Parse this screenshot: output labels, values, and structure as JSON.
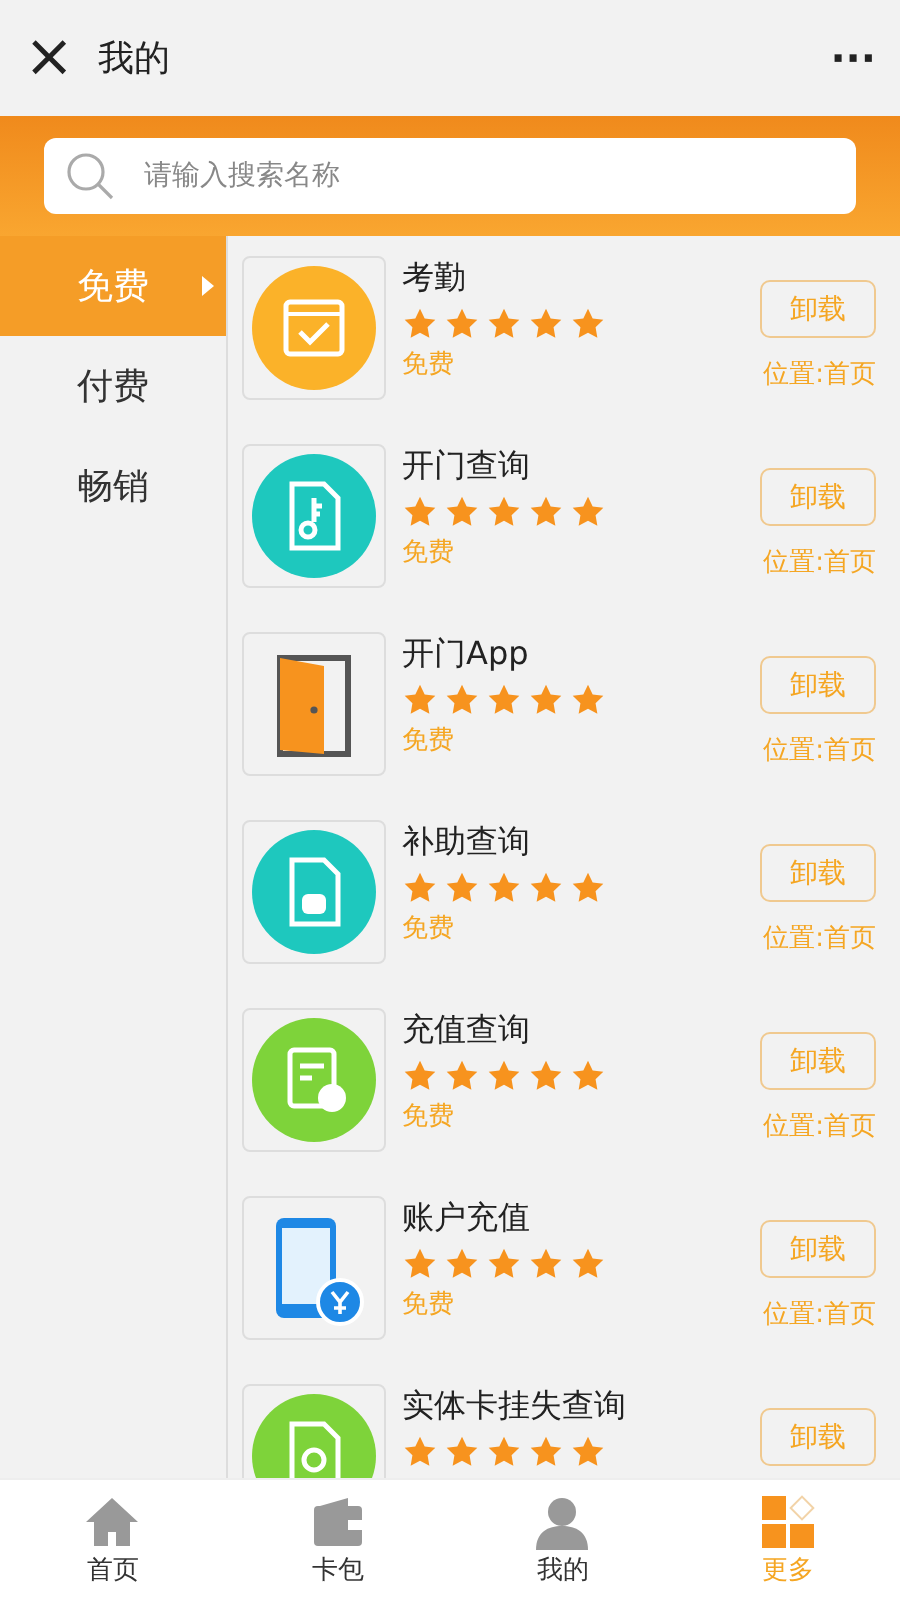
{
  "header": {
    "close": "×",
    "title": "我的",
    "more": "···"
  },
  "search": {
    "placeholder": "请输入搜索名称"
  },
  "sidebar": {
    "items": [
      {
        "label": "免费",
        "selected": true
      },
      {
        "label": "付费",
        "selected": false
      },
      {
        "label": "畅销",
        "selected": false
      }
    ]
  },
  "apps": [
    {
      "kind": "calendar",
      "name": "考勤",
      "stars": 5,
      "price": "免费",
      "action": "卸载",
      "location": "位置:首页"
    },
    {
      "kind": "key-doc",
      "name": "开门查询",
      "stars": 5,
      "price": "免费",
      "action": "卸载",
      "location": "位置:首页"
    },
    {
      "kind": "door",
      "name": "开门App",
      "stars": 5,
      "price": "免费",
      "action": "卸载",
      "location": "位置:首页"
    },
    {
      "kind": "money-doc",
      "name": "补助查询",
      "stars": 5,
      "price": "免费",
      "action": "卸载",
      "location": "位置:首页"
    },
    {
      "kind": "recharge",
      "name": "充值查询",
      "stars": 5,
      "price": "免费",
      "action": "卸载",
      "location": "位置:首页"
    },
    {
      "kind": "phone",
      "name": "账户充值",
      "stars": 5,
      "price": "免费",
      "action": "卸载",
      "location": "位置:首页"
    },
    {
      "kind": "card-doc",
      "name": "实体卡挂失查询",
      "stars": 5,
      "action": "卸载"
    }
  ],
  "tabs": [
    {
      "kind": "home",
      "label": "首页",
      "selected": false
    },
    {
      "kind": "wallet",
      "label": "卡包",
      "selected": false
    },
    {
      "kind": "person",
      "label": "我的",
      "selected": false
    },
    {
      "kind": "grid",
      "label": "更多",
      "selected": true
    }
  ]
}
